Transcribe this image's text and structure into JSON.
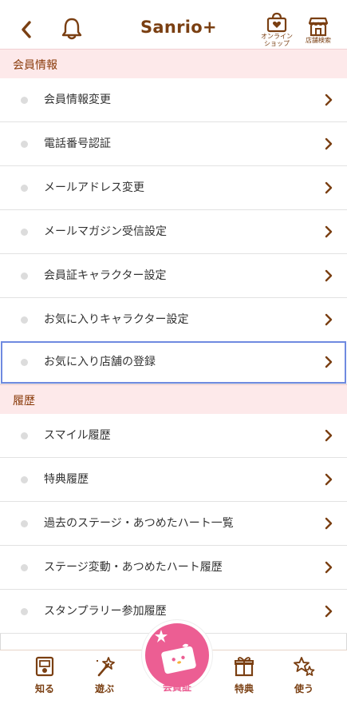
{
  "header": {
    "logo": "Sanrio+",
    "shop_label_1": "オンライン",
    "shop_label_2": "ショップ",
    "store_label": "店舗検索"
  },
  "sections": [
    {
      "title": "会員情報",
      "items": [
        "会員情報変更",
        "電話番号認証",
        "メールアドレス変更",
        "メールマガジン受信設定",
        "会員証キャラクター設定",
        "お気に入りキャラクター設定",
        "お気に入り店舗の登録"
      ]
    },
    {
      "title": "履歴",
      "items": [
        "スマイル履歴",
        "特典履歴",
        "過去のステージ・あつめたハート一覧",
        "ステージ変動・あつめたハート履歴",
        "スタンプラリー参加履歴"
      ]
    }
  ],
  "nav": {
    "items": [
      "知る",
      "遊ぶ",
      "会員証",
      "特典",
      "使う"
    ],
    "active": "会員証"
  },
  "colors": {
    "brown": "#7a3f12",
    "pink_section": "#fde9ea",
    "accent_pink": "#ec5e93",
    "selection": "#6f8ae0"
  }
}
